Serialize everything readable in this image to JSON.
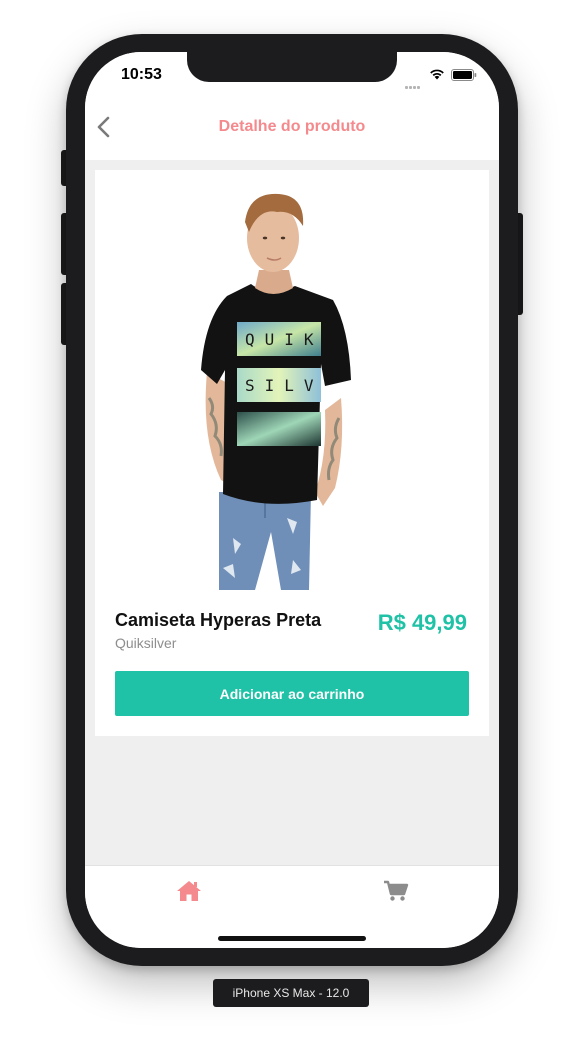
{
  "status_bar": {
    "time": "10:53"
  },
  "nav": {
    "title": "Detalhe do produto"
  },
  "product": {
    "name": "Camiseta Hyperas Preta",
    "brand": "Quiksilver",
    "price": "R$ 49,99",
    "add_to_cart_label": "Adicionar ao carrinho"
  },
  "tab_bar": {
    "items": [
      {
        "icon": "home-icon",
        "active": true
      },
      {
        "icon": "cart-icon",
        "active": false
      }
    ]
  },
  "device_label": "iPhone XS Max - 12.0",
  "colors": {
    "accent": "#1fc2a6",
    "title": "#f48a8d",
    "background": "#efefef",
    "text_muted": "#8e8e8e"
  }
}
